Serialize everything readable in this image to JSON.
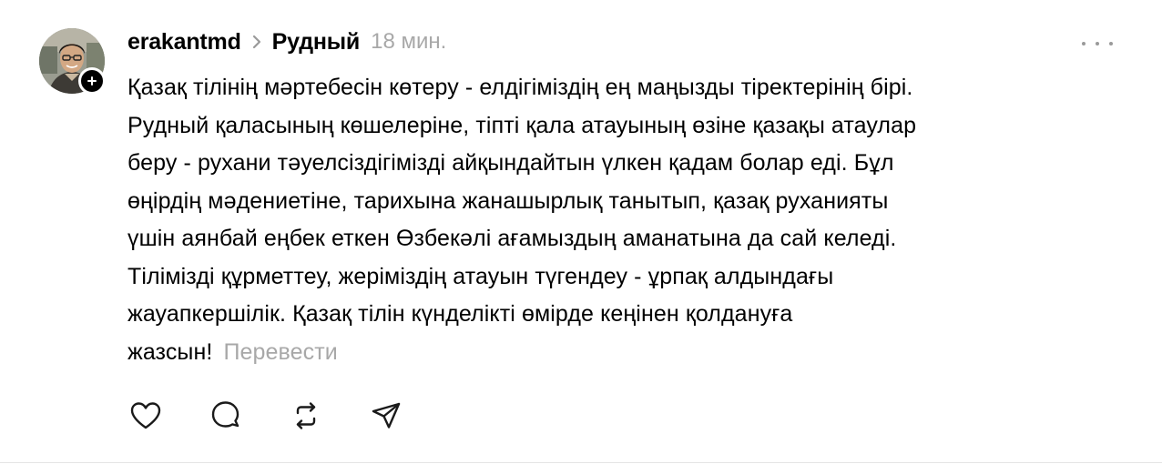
{
  "post": {
    "username": "erakantmd",
    "topic": "Рудный",
    "time": "18 мин.",
    "lines": [
      "Қазақ тілінің мәртебесін көтеру - елдігіміздің ең маңызды тіректерінің бірі.",
      "Рудный қаласының көшелеріне, тіпті қала атауының өзіне қазақы атаулар",
      "беру - рухани тәуелсіздігімізді айқындайтын үлкен қадам болар еді. Бұл",
      "өңірдің мәдениетіне, тарихына жанашырлық танытып, қазақ руханияты",
      "үшін аянбай еңбек еткен Өзбекәлі ағамыздың аманатына да сай келеді.",
      "Тілімізді құрметтеу, жеріміздің атауын түгендеу - ұрпақ алдындағы",
      "жауапкершілік. Қазақ тілін күнделікті өмірде кеңінен қолдануға",
      "жазсын!"
    ],
    "translate_label": "Перевести"
  },
  "icons": {
    "avatar": "user-avatar-photo",
    "follow": "plus-icon",
    "chevron": "chevron-right-icon",
    "more": "more-dots-icon",
    "like": "heart-icon",
    "reply": "comment-bubble-icon",
    "repost": "repost-icon",
    "share": "send-icon"
  },
  "colors": {
    "text": "#000000",
    "muted": "#a8a8a8",
    "icon": "#1a1a1a",
    "divider": "#e5e5e5"
  }
}
